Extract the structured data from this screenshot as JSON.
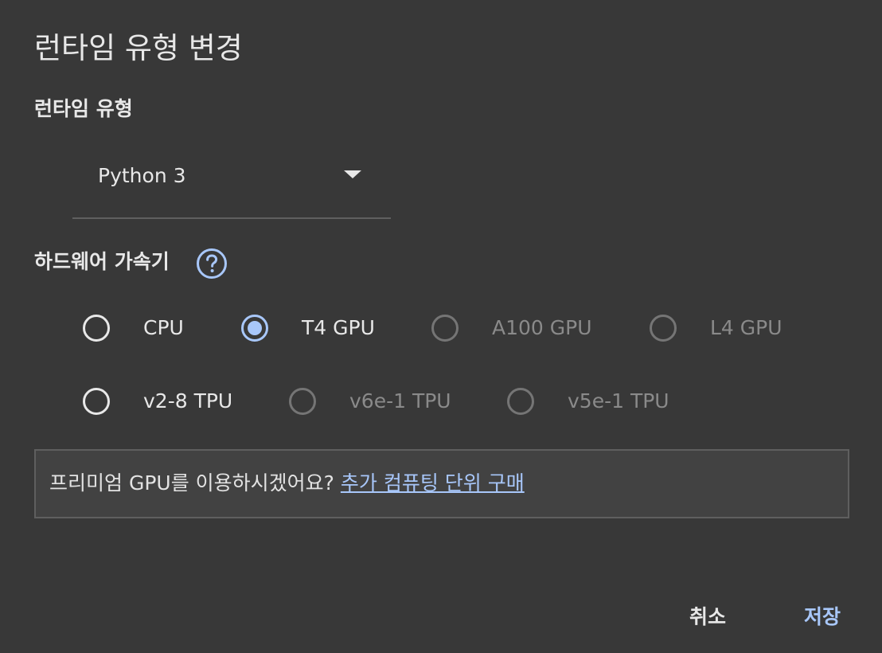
{
  "dialog": {
    "title": "런타임 유형 변경"
  },
  "runtime": {
    "label": "런타임 유형",
    "selected": "Python 3"
  },
  "accelerator": {
    "label": "하드웨어 가속기",
    "help_icon": "help-circle-icon",
    "options": [
      {
        "label": "CPU",
        "selected": false,
        "disabled": false
      },
      {
        "label": "T4 GPU",
        "selected": true,
        "disabled": false
      },
      {
        "label": "A100 GPU",
        "selected": false,
        "disabled": true
      },
      {
        "label": "L4 GPU",
        "selected": false,
        "disabled": true
      },
      {
        "label": "v2-8 TPU",
        "selected": false,
        "disabled": false
      },
      {
        "label": "v6e-1 TPU",
        "selected": false,
        "disabled": true
      },
      {
        "label": "v5e-1 TPU",
        "selected": false,
        "disabled": true
      }
    ]
  },
  "premium": {
    "text": "프리미엄 GPU를 이용하시겠어요?",
    "link": "추가 컴퓨팅 단위 구매"
  },
  "actions": {
    "cancel": "취소",
    "save": "저장"
  },
  "colors": {
    "background": "#383838",
    "accent": "#a8c7fa",
    "text": "#e8e8e8",
    "disabled_text": "#8a8a8a"
  }
}
